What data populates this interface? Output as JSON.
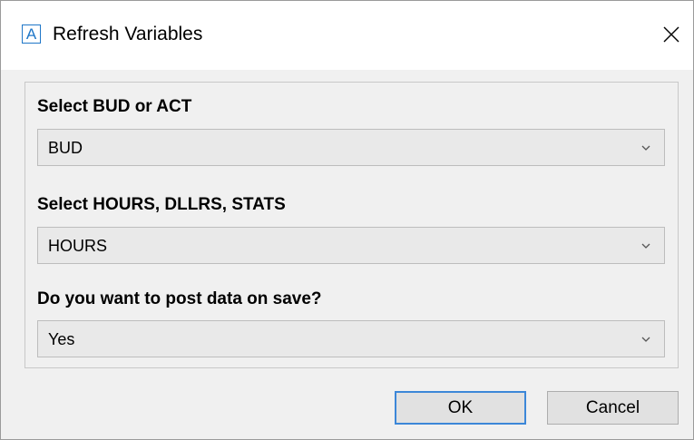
{
  "window": {
    "title": "Refresh Variables",
    "app_icon_letter": "A",
    "accent_color": "#3c87d8",
    "close_icon": "close-icon"
  },
  "fields": [
    {
      "label": "Select BUD or ACT",
      "value": "BUD"
    },
    {
      "label": "Select HOURS, DLLRS, STATS",
      "value": "HOURS"
    },
    {
      "label": "Do you want to post data on save?",
      "value": "Yes"
    }
  ],
  "buttons": {
    "ok_label": "OK",
    "cancel_label": "Cancel"
  }
}
